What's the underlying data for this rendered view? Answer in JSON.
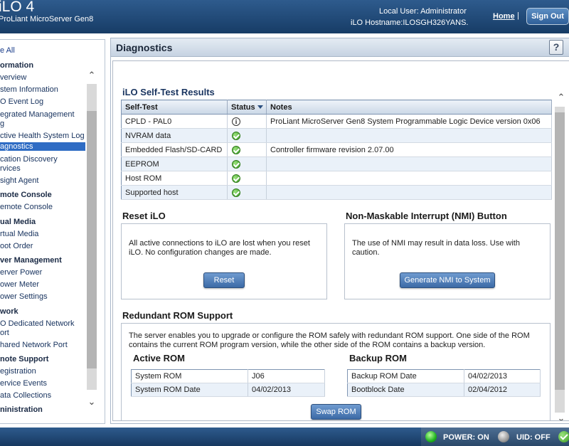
{
  "header": {
    "title": "iLO 4",
    "subtitle": "ProLiant MicroServer Gen8",
    "local_user": "Local User:  Administrator",
    "hostname": "iLO Hostname:ILOSGH326YANS.",
    "home_link": "Home",
    "separator": "|",
    "signout_label": "Sign Out"
  },
  "sidebar": {
    "items": [
      {
        "label": "e All",
        "kind": "top-link"
      },
      {
        "label": "ormation",
        "kind": "section"
      },
      {
        "label": "verview",
        "kind": "item"
      },
      {
        "label": "stem Information",
        "kind": "item"
      },
      {
        "label": "O Event Log",
        "kind": "item"
      },
      {
        "label": "egrated Management",
        "kind": "item"
      },
      {
        "label": "g",
        "kind": "item"
      },
      {
        "label": "ctive Health System Log",
        "kind": "item"
      },
      {
        "label": "agnostics",
        "kind": "selected"
      },
      {
        "label": "cation Discovery",
        "kind": "item"
      },
      {
        "label": "rvices",
        "kind": "item"
      },
      {
        "label": "sight Agent",
        "kind": "item"
      },
      {
        "label": "mote Console",
        "kind": "section"
      },
      {
        "label": "emote Console",
        "kind": "item"
      },
      {
        "label": "ual Media",
        "kind": "section"
      },
      {
        "label": "rtual Media",
        "kind": "item"
      },
      {
        "label": "oot Order",
        "kind": "item"
      },
      {
        "label": "ver Management",
        "kind": "section"
      },
      {
        "label": "erver Power",
        "kind": "item"
      },
      {
        "label": "ower Meter",
        "kind": "item"
      },
      {
        "label": "ower Settings",
        "kind": "item"
      },
      {
        "label": "work",
        "kind": "section"
      },
      {
        "label": "O Dedicated Network",
        "kind": "item"
      },
      {
        "label": "ort",
        "kind": "item"
      },
      {
        "label": "hared Network Port",
        "kind": "item"
      },
      {
        "label": "note Support",
        "kind": "section"
      },
      {
        "label": "egistration",
        "kind": "item"
      },
      {
        "label": "ervice Events",
        "kind": "item"
      },
      {
        "label": "ata Collections",
        "kind": "item"
      },
      {
        "label": "ninistration",
        "kind": "section"
      }
    ]
  },
  "panel": {
    "title": "Diagnostics",
    "help": "?"
  },
  "self_test": {
    "title": "iLO Self-Test Results",
    "columns": [
      "Self-Test",
      "Status",
      "Notes"
    ],
    "rows": [
      {
        "test": "CPLD - PAL0",
        "status_icon": "info-icon",
        "notes": "ProLiant MicroServer Gen8 System Programmable Logic Device version 0x06"
      },
      {
        "test": "NVRAM data",
        "status_icon": "ok-icon",
        "notes": ""
      },
      {
        "test": "Embedded Flash/SD-CARD",
        "status_icon": "ok-icon",
        "notes": "Controller firmware revision 2.07.00"
      },
      {
        "test": "EEPROM",
        "status_icon": "ok-icon",
        "notes": ""
      },
      {
        "test": "Host ROM",
        "status_icon": "ok-icon",
        "notes": ""
      },
      {
        "test": "Supported host",
        "status_icon": "ok-icon",
        "notes": ""
      }
    ]
  },
  "reset": {
    "title": "Reset iLO",
    "text": "All active connections to iLO are lost when you reset iLO. No configuration changes are made.",
    "button": "Reset"
  },
  "nmi": {
    "title": "Non-Maskable Interrupt (NMI) Button",
    "text": "The use of NMI may result in data loss. Use with caution.",
    "button": "Generate NMI to System"
  },
  "rom": {
    "title": "Redundant ROM Support",
    "text": "The server enables you to upgrade or configure the ROM safely with redundant ROM support. One side of the ROM contains the current ROM program version, while the other side of the ROM contains a backup version.",
    "active_title": "Active ROM",
    "active_rows": [
      [
        "System ROM",
        "J06"
      ],
      [
        "System ROM Date",
        "04/02/2013"
      ]
    ],
    "backup_title": "Backup ROM",
    "backup_rows": [
      [
        "Backup ROM Date",
        "04/02/2013"
      ],
      [
        "Bootblock Date",
        "02/04/2012"
      ]
    ],
    "swap_button": "Swap ROM"
  },
  "footer": {
    "power_label": "POWER: ON",
    "uid_label": "UID: OFF"
  },
  "colors": {
    "header_blue": "#173c66",
    "selected_blue": "#2f6cc4",
    "ok_green": "#3a9a22"
  }
}
